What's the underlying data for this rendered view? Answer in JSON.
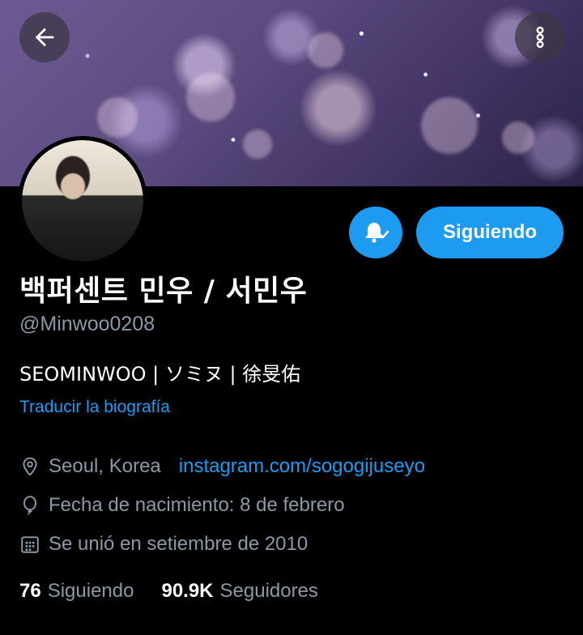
{
  "header": {
    "back_icon": "arrow-left-icon",
    "more_icon": "more-vertical-icon"
  },
  "profile": {
    "display_name": "백퍼센트 민우 / 서민우",
    "handle": "@Minwoo0208",
    "bio": "SEOMINWOO | ソミヌ | 徐旻佑",
    "translate_label": "Traducir la biografía",
    "location": "Seoul, Korea",
    "website": "instagram.com/sogogijuseyo",
    "birthday": "Fecha de nacimiento: 8 de febrero",
    "joined": "Se unió en setiembre de 2010"
  },
  "actions": {
    "follow_label": "Siguiendo",
    "notify_icon": "bell-check-icon"
  },
  "stats": {
    "following_count": "76",
    "following_label": "Siguiendo",
    "followers_count": "90.9K",
    "followers_label": "Seguidores"
  },
  "colors": {
    "accent": "#1d9bf0",
    "background": "#000000",
    "secondary_text": "#8b98a5"
  }
}
